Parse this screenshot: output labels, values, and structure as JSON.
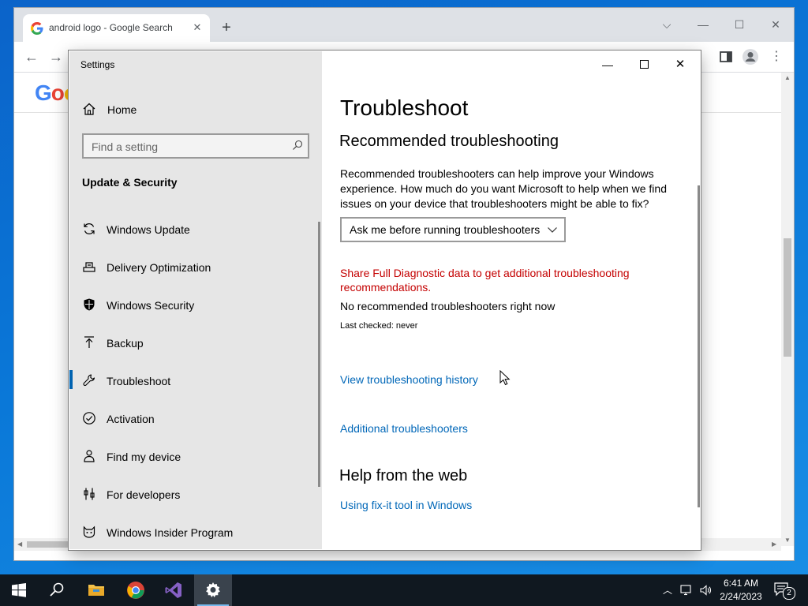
{
  "chrome": {
    "tab_title": "android logo - Google Search",
    "google_logo_partial": "Goo"
  },
  "settings": {
    "window_title": "Settings",
    "home_label": "Home",
    "search_placeholder": "Find a setting",
    "section_heading": "Update & Security",
    "nav_items": [
      {
        "label": "Windows Update",
        "icon": "refresh-icon"
      },
      {
        "label": "Delivery Optimization",
        "icon": "delivery-optimization-icon"
      },
      {
        "label": "Windows Security",
        "icon": "shield-icon"
      },
      {
        "label": "Backup",
        "icon": "backup-arrow-icon"
      },
      {
        "label": "Troubleshoot",
        "icon": "wrench-icon",
        "active": true
      },
      {
        "label": "Activation",
        "icon": "check-circle-icon"
      },
      {
        "label": "Find my device",
        "icon": "person-pin-icon"
      },
      {
        "label": "For developers",
        "icon": "developer-tools-icon"
      },
      {
        "label": "Windows Insider Program",
        "icon": "insider-cat-icon"
      }
    ],
    "main": {
      "title": "Troubleshoot",
      "recommended_heading": "Recommended troubleshooting",
      "recommended_desc": "Recommended troubleshooters can help improve your Windows experience. How much do you want Microsoft to help when we find issues on your device that troubleshooters might be able to fix?",
      "dropdown_value": "Ask me before running troubleshooters",
      "diagnostic_link": "Share Full Diagnostic data to get additional troubleshooting recommendations.",
      "no_recommended": "No recommended troubleshooters right now",
      "last_checked": "Last checked: never",
      "history_link": "View troubleshooting history",
      "additional_link": "Additional troubleshooters",
      "help_heading": "Help from the web",
      "help_link": "Using fix-it tool in Windows"
    }
  },
  "taskbar": {
    "time": "6:41 AM",
    "date": "2/24/2023",
    "notification_count": "2",
    "apps": [
      "start",
      "search",
      "file-explorer",
      "chrome",
      "visual-studio",
      "settings"
    ]
  },
  "colors": {
    "accent": "#0063b1",
    "link": "#0067b8",
    "warning_link": "#c40000",
    "sidebar_bg": "#e6e6e6",
    "taskbar_bg": "#101820"
  }
}
